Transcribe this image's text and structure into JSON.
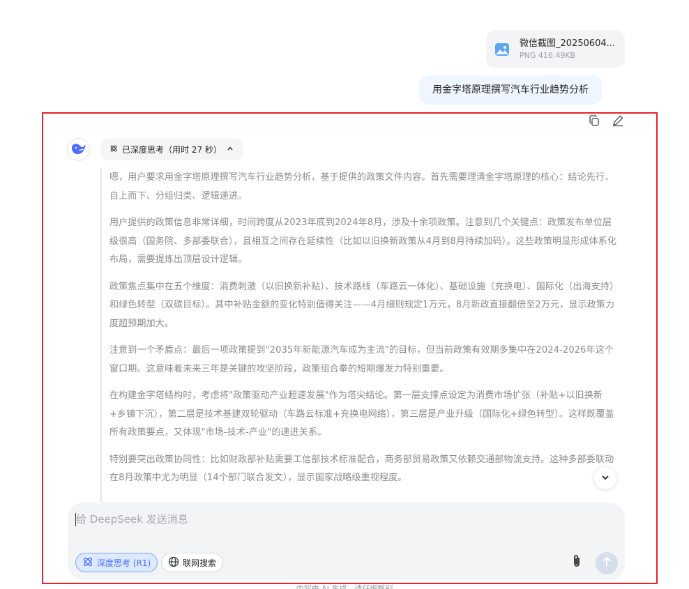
{
  "attachment": {
    "file_name": "微信截图_20250604...",
    "file_info": "PNG 416.49KB",
    "icon": "image-file-icon"
  },
  "user_message": "用金字塔原理撰写汽车行业趋势分析",
  "assistant": {
    "avatar_icon": "deepseek-whale-icon",
    "think_label": "已深度思考（用时 27 秒）",
    "reasoning": [
      "嗯，用户要求用金字塔原理撰写汽车行业趋势分析，基于提供的政策文件内容。首先需要理清金字塔原理的核心：结论先行、自上而下、分组归类、逻辑递进。",
      "用户提供的政策信息非常详细，时间跨度从2023年底到2024年8月，涉及十余项政策。注意到几个关键点：政策发布单位层级很高（国务院、多部委联合），且相互之间存在延续性（比如以旧换新政策从4月到8月持续加码）。这些政策明显形成体系化布局，需要提炼出顶层设计逻辑。",
      "政策焦点集中在五个维度：消费刺激（以旧换新补贴）、技术路线（车路云一体化）、基础设施（充换电）、国际化（出海支持）和绿色转型（双碳目标）。其中补贴金额的变化特别值得关注——4月细则规定1万元，8月新政直接翻倍至2万元，显示政策力度超预期加大。",
      "注意到一个矛盾点：最后一项政策提到\"2035年新能源汽车成为主流\"的目标，但当前政策有效期多集中在2024-2026年这个窗口期。这意味着未来三年是关键的攻坚阶段，政策组合拳的短期爆发力特别重要。",
      "在构建金字塔结构时，考虑将\"政策驱动产业超速发展\"作为塔尖结论。第一层支撑点设定为消费市场扩张（补贴+以旧换新+乡镇下沉），第二层是技术基建双轮驱动（车路云标准+充换电网络），第三层是产业升级（国际化+绿色转型）。这样既覆盖所有政策要点，又体现\"市场-技术-产业\"的递进关系。",
      "特别要突出政策协同性：比如财政部补贴需要工信部技术标准配合，商务部贸易政策又依赖交通部物流支持。这种多部委联动在8月政策中尤为明显（14个部门联合发文），显示国家战略级重视程度。"
    ]
  },
  "composer": {
    "placeholder": "给 DeepSeek 发送消息",
    "deepthink_label": "深度思考 (R1)",
    "search_label": "联网搜索"
  },
  "disclaimer": "内容由 AI 生成，请仔细甄别",
  "colors": {
    "accent": "#4d6bfe",
    "highlight": "#e8212d",
    "user_bubble": "#eff6ff",
    "reasoning_text": "#8b8b8b"
  }
}
